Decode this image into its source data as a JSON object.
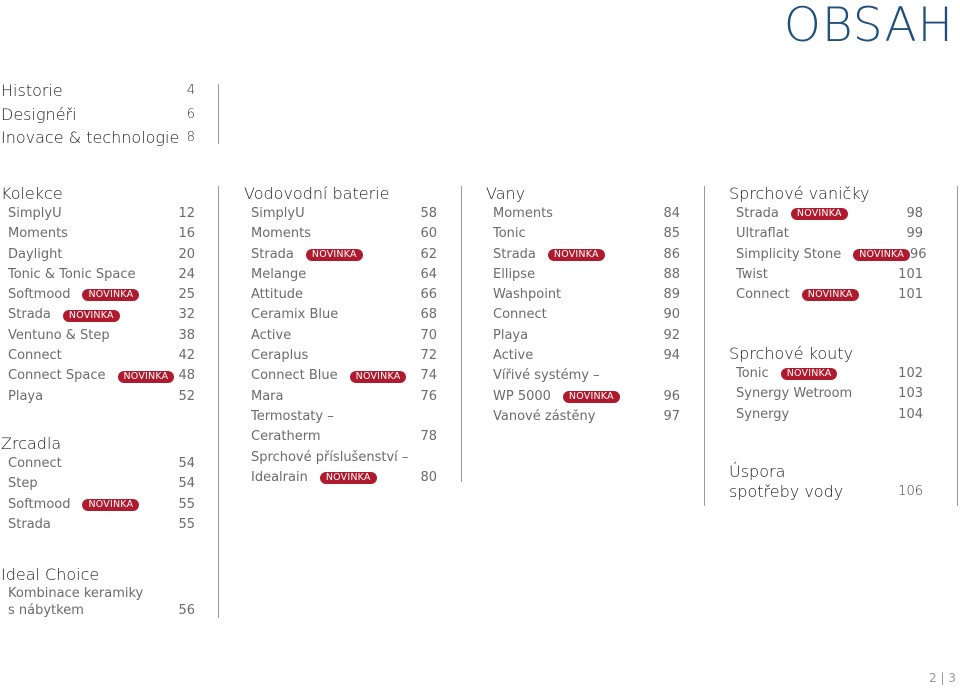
{
  "title": "OBSAH",
  "top": [
    {
      "label": "Historie",
      "page": "4"
    },
    {
      "label": "Designéři",
      "page": "6"
    },
    {
      "label": "Inovace & technologie",
      "page": "8"
    }
  ],
  "badge_label": "NOVINKA",
  "colors": {
    "title": "#1e4f7d",
    "badge": "#b01a2e"
  },
  "kolekce": {
    "heading": "Kolekce",
    "items": [
      {
        "label": "SimplyU",
        "page": "12"
      },
      {
        "label": "Moments",
        "page": "16"
      },
      {
        "label": "Daylight",
        "page": "20"
      },
      {
        "label": "Tonic & Tonic Space",
        "page": "24"
      },
      {
        "label": "Softmood",
        "page": "25",
        "new": true
      },
      {
        "label": "Strada",
        "page": "32",
        "new": true
      },
      {
        "label": "Ventuno & Step",
        "page": "38"
      },
      {
        "label": "Connect",
        "page": "42"
      },
      {
        "label": "Connect Space",
        "page": "48",
        "new": true
      },
      {
        "label": "Playa",
        "page": "52"
      }
    ]
  },
  "zrcadla": {
    "heading": "Zrcadla",
    "items": [
      {
        "label": "Connect",
        "page": "54"
      },
      {
        "label": "Step",
        "page": "54"
      },
      {
        "label": "Softmood",
        "page": "55",
        "new": true
      },
      {
        "label": "Strada",
        "page": "55"
      }
    ]
  },
  "ideal_choice": {
    "heading": "Ideal Choice",
    "items": [
      {
        "line1": "Kombinace keramiky",
        "line2": "s nábytkem",
        "page": "56"
      }
    ]
  },
  "vodovodni": {
    "heading": "Vodovodní baterie",
    "items": [
      {
        "label": "SimplyU",
        "page": "58"
      },
      {
        "label": "Moments",
        "page": "60"
      },
      {
        "label": "Strada",
        "page": "62",
        "new": true
      },
      {
        "label": "Melange",
        "page": "64"
      },
      {
        "label": "Attitude",
        "page": "66"
      },
      {
        "label": "Ceramix Blue",
        "page": "68"
      },
      {
        "label": "Active",
        "page": "70"
      },
      {
        "label": "Ceraplus",
        "page": "72"
      },
      {
        "label": "Connect Blue",
        "page": "74",
        "new": true
      },
      {
        "label": "Mara",
        "page": "76"
      },
      {
        "line1": "Termostaty –",
        "line2": "Ceratherm",
        "page": "78"
      },
      {
        "line1": "Sprchové příslušenství –",
        "line2": "Idealrain",
        "page": "80",
        "new": true
      }
    ]
  },
  "vany": {
    "heading": "Vany",
    "items": [
      {
        "label": "Moments",
        "page": "84"
      },
      {
        "label": "Tonic",
        "page": "85"
      },
      {
        "label": "Strada",
        "page": "86",
        "new": true
      },
      {
        "label": "Ellipse",
        "page": "88"
      },
      {
        "label": "Washpoint",
        "page": "89"
      },
      {
        "label": "Connect",
        "page": "90"
      },
      {
        "label": "Playa",
        "page": "92"
      },
      {
        "label": "Active",
        "page": "94"
      },
      {
        "line1": "Vířivé systémy –",
        "line2": "WP 5000",
        "page": "96",
        "new": true
      },
      {
        "label": "Vanové zástěny",
        "page": "97"
      }
    ]
  },
  "vanicky": {
    "heading": "Sprchové vaničky",
    "items": [
      {
        "label": "Strada",
        "page": "98",
        "new": true
      },
      {
        "label": "Ultraflat",
        "page": "99"
      },
      {
        "label": "Simplicity Stone",
        "page": "96",
        "new": true
      },
      {
        "label": "Twist",
        "page": "101"
      },
      {
        "label": "Connect",
        "page": "101",
        "new": true
      }
    ]
  },
  "kouty": {
    "heading": "Sprchové kouty",
    "items": [
      {
        "label": "Tonic",
        "page": "102",
        "new": true
      },
      {
        "label": "Synergy Wetroom",
        "page": "103"
      },
      {
        "label": "Synergy",
        "page": "104"
      }
    ]
  },
  "uspora": {
    "line1": "Úspora",
    "line2": "spotřeby vody",
    "page": "106"
  },
  "page_number": "2 | 3"
}
